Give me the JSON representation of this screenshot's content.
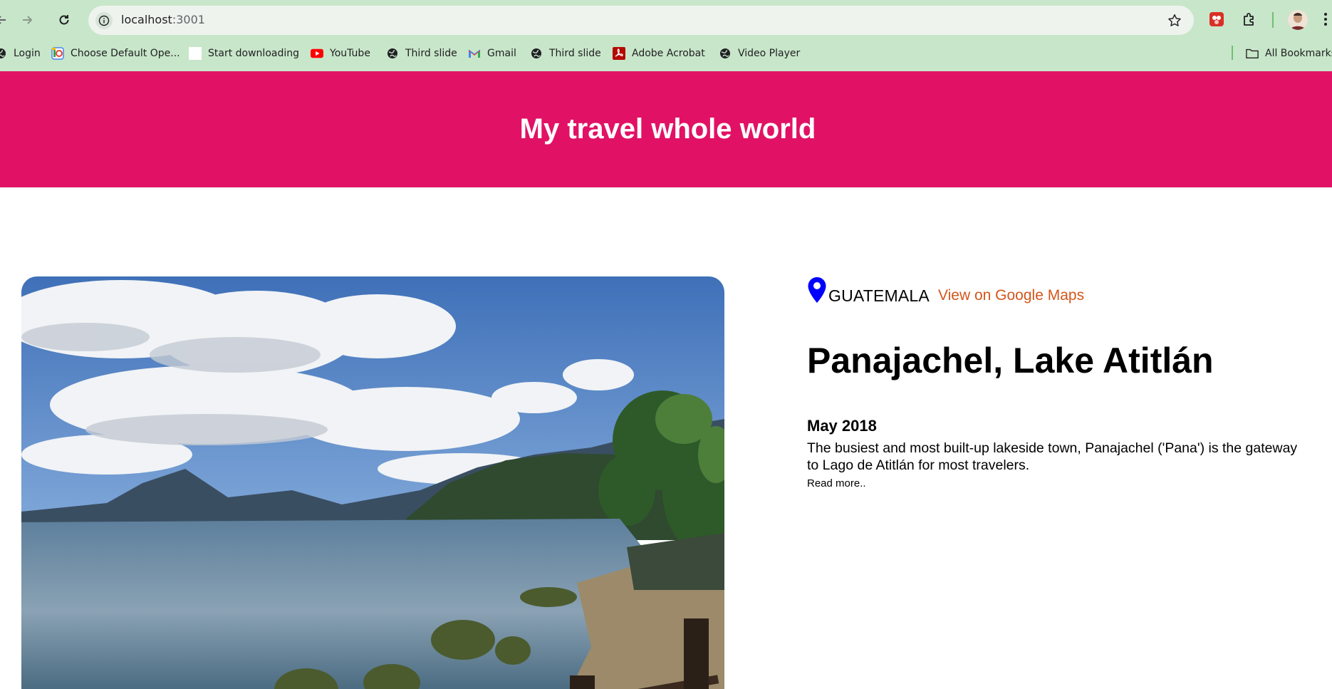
{
  "browser": {
    "url_host": "localhost",
    "url_port": ":3001",
    "bookmarks": [
      {
        "label": "Login",
        "icon": "globe-icon"
      },
      {
        "label": "Choose Default Ope...",
        "icon": "colorful-app-icon"
      },
      {
        "label": "Start downloading",
        "icon": "blank-page-icon"
      },
      {
        "label": "YouTube",
        "icon": "youtube-icon"
      },
      {
        "label": "Third slide",
        "icon": "globe-icon"
      },
      {
        "label": "Gmail",
        "icon": "gmail-icon"
      },
      {
        "label": "Third slide",
        "icon": "globe-icon"
      },
      {
        "label": "Adobe Acrobat",
        "icon": "acrobat-icon"
      },
      {
        "label": "Video Player",
        "icon": "globe-icon"
      }
    ],
    "all_bookmarks_label": "All Bookmarks"
  },
  "page": {
    "banner_title": "My travel whole world",
    "banner_color": "#e11265",
    "entry": {
      "country": "GUATEMALA",
      "maps_link": "View on Google Maps",
      "title": "Panajachel, Lake Atitlán",
      "date": "May 2018",
      "description": "The busiest and most built-up lakeside town, Panajachel ('Pana') is the gateway to Lago de Atitlán for most travelers.",
      "read_more": "Read more..",
      "link_color": "#d2561b",
      "pin_color": "#0000ff"
    }
  }
}
